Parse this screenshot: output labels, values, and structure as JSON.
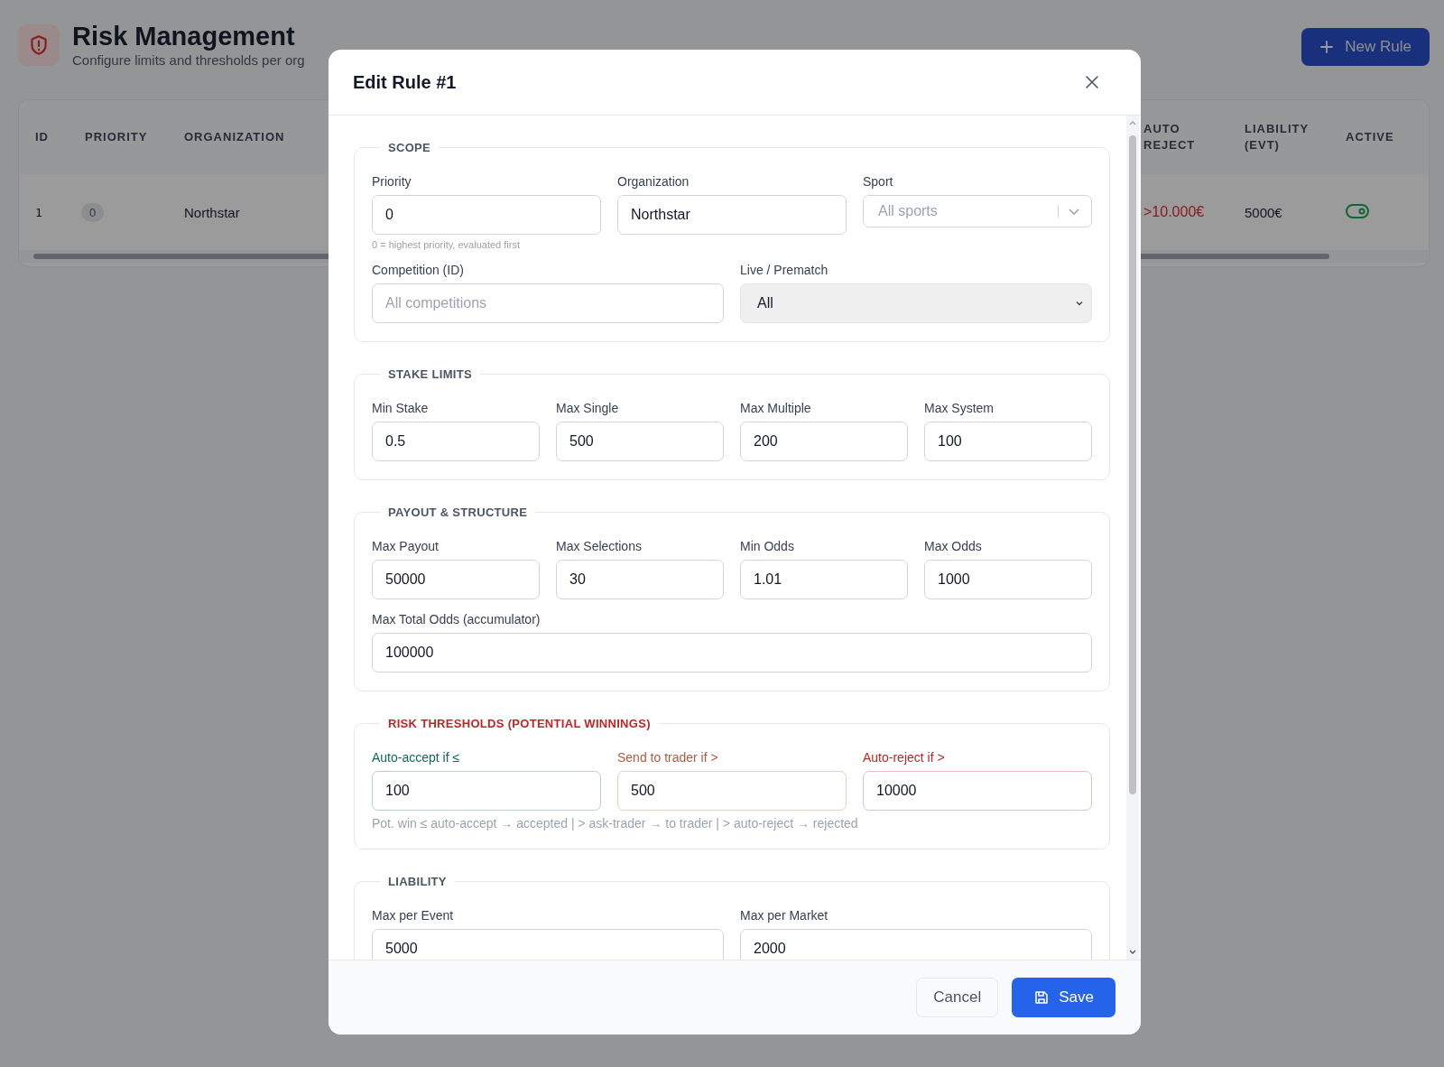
{
  "page": {
    "title": "Risk Management",
    "subtitle": "Configure limits and thresholds per org",
    "new_button": "New Rule"
  },
  "table": {
    "columns": [
      {
        "lines": [
          "ID"
        ]
      },
      {
        "lines": [
          "PRIORITY"
        ]
      },
      {
        "lines": [
          "ORGANIZATION"
        ]
      },
      {
        "lines": [
          "AUTO",
          "REJECT"
        ]
      },
      {
        "lines": [
          "LIABILITY",
          "(EVT)"
        ]
      },
      {
        "lines": [
          "ACTIVE"
        ]
      }
    ],
    "rows": [
      {
        "id": "1",
        "priority": "0",
        "organization": "Northstar",
        "auto_reject": ">10.000€",
        "liability": "5000€",
        "active": true
      }
    ]
  },
  "modal": {
    "title": "Edit Rule #1",
    "sections": [
      {
        "title": "SCOPE",
        "rows": [
          [
            {
              "label": "Priority",
              "kind": "input",
              "value": "0",
              "hint": "0 = highest priority, evaluated first"
            },
            {
              "label": "Organization",
              "kind": "input",
              "value": "Northstar"
            },
            {
              "label": "Sport",
              "kind": "combobox",
              "placeholder": "All sports"
            }
          ],
          [
            {
              "label": "Competition (ID)",
              "kind": "input",
              "placeholder": "All competitions"
            },
            {
              "label": "Live / Prematch",
              "kind": "select",
              "value": "All"
            }
          ]
        ]
      },
      {
        "title": "STAKE LIMITS",
        "rows": [
          [
            {
              "label": "Min Stake",
              "kind": "input",
              "value": "0.5"
            },
            {
              "label": "Max Single",
              "kind": "input",
              "value": "500"
            },
            {
              "label": "Max Multiple",
              "kind": "input",
              "value": "200"
            },
            {
              "label": "Max System",
              "kind": "input",
              "value": "100"
            }
          ]
        ]
      },
      {
        "title": "PAYOUT & STRUCTURE",
        "rows": [
          [
            {
              "label": "Max Payout",
              "kind": "input",
              "value": "50000"
            },
            {
              "label": "Max Selections",
              "kind": "input",
              "value": "30"
            },
            {
              "label": "Min Odds",
              "kind": "input",
              "value": "1.01"
            },
            {
              "label": "Max Odds",
              "kind": "input",
              "value": "1000"
            }
          ],
          [
            {
              "label": "Max Total Odds (accumulator)",
              "kind": "input",
              "value": "100000"
            }
          ]
        ]
      },
      {
        "title": "RISK THRESHOLDS (POTENTIAL WINNINGS)",
        "color": "#c02626",
        "note": "Pot. win ≤ auto-accept → accepted | > ask-trader → to trader | > auto-reject → rejected",
        "rows": [
          [
            {
              "label": "Auto-accept if ≤",
              "kind": "input",
              "value": "100",
              "color": "#0f6b4f"
            },
            {
              "label": "Send to trader if >",
              "kind": "input",
              "value": "500",
              "color": "#b45a3c"
            },
            {
              "label": "Auto-reject if >",
              "kind": "input",
              "value": "10000",
              "color": "#c02626"
            }
          ]
        ]
      },
      {
        "title": "LIABILITY",
        "rows": [
          [
            {
              "label": "Max per Event",
              "kind": "input",
              "value": "5000"
            },
            {
              "label": "Max per Market",
              "kind": "input",
              "value": "2000"
            }
          ]
        ]
      }
    ],
    "buttons": [
      {
        "label": "Cancel",
        "kind": "secondary"
      },
      {
        "label": "Save",
        "kind": "primary"
      }
    ]
  }
}
